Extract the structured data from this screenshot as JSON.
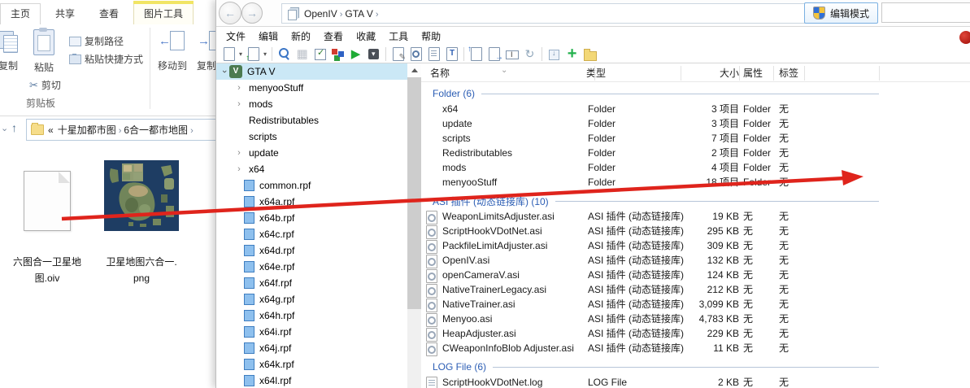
{
  "explorer": {
    "tabs": [
      {
        "id": "home",
        "label": "主页",
        "active": true,
        "contextual": false
      },
      {
        "id": "share",
        "label": "共享",
        "active": false,
        "contextual": false
      },
      {
        "id": "view",
        "label": "查看",
        "active": false,
        "contextual": false
      },
      {
        "id": "picture-tools",
        "label": "图片工具",
        "active": false,
        "contextual": true
      }
    ],
    "ribbon": {
      "copy": "复制",
      "paste": "粘贴",
      "cut": "剪切",
      "copy_path": "复制路径",
      "paste_shortcut": "粘贴快捷方式",
      "clipboard_group": "剪贴板",
      "move_to": "移动到",
      "copy_to": "复制到"
    },
    "address": {
      "prefix": "«",
      "crumbs": [
        "十星加都市图",
        "6合一都市地图"
      ]
    },
    "files": [
      {
        "id": "oiv",
        "name": "六图合一卫星地图.oiv",
        "line1": "六图合一卫星地",
        "line2": "图.oiv",
        "icon": "oiv-document"
      },
      {
        "id": "png",
        "name": "卫星地图六合一.png",
        "line1": "卫星地图六合一.",
        "line2": "png",
        "icon": "map-thumbnail"
      }
    ]
  },
  "openiv": {
    "breadcrumbs": [
      "OpenIV",
      "GTA V"
    ],
    "edit_mode_label": "编辑模式",
    "menus": [
      {
        "id": "file",
        "label": "文件"
      },
      {
        "id": "edit",
        "label": "编辑"
      },
      {
        "id": "new",
        "label": "新的"
      },
      {
        "id": "view",
        "label": "查看"
      },
      {
        "id": "favorites",
        "label": "收藏"
      },
      {
        "id": "tools",
        "label": "工具"
      },
      {
        "id": "help",
        "label": "帮助"
      }
    ],
    "toolbar": [
      {
        "id": "new-file",
        "drop": true
      },
      {
        "id": "import-file",
        "drop": true
      },
      {
        "sep": true
      },
      {
        "id": "search"
      },
      {
        "id": "settings"
      },
      {
        "id": "checklist"
      },
      {
        "id": "palette"
      },
      {
        "id": "play"
      },
      {
        "id": "save"
      },
      {
        "sep": true
      },
      {
        "id": "edit"
      },
      {
        "id": "preview"
      },
      {
        "id": "view-text"
      },
      {
        "id": "text-editor"
      },
      {
        "sep": true
      },
      {
        "id": "export"
      },
      {
        "id": "copy"
      },
      {
        "id": "rename"
      },
      {
        "id": "refresh"
      },
      {
        "sep": true
      },
      {
        "id": "extract"
      },
      {
        "id": "add"
      },
      {
        "id": "new-folder"
      }
    ],
    "tree": {
      "root": "GTA V",
      "items": [
        {
          "label": "menyooStuff",
          "icon": "folder-yellow",
          "expandable": true
        },
        {
          "label": "mods",
          "icon": "folder-purple",
          "expandable": true
        },
        {
          "label": "Redistributables",
          "icon": "folder-yellow",
          "expandable": false
        },
        {
          "label": "scripts",
          "icon": "folder-yellow",
          "expandable": false
        },
        {
          "label": "update",
          "icon": "folder-blue",
          "expandable": true
        },
        {
          "label": "x64",
          "icon": "folder-teal",
          "expandable": true
        },
        {
          "label": "common.rpf",
          "icon": "rpf",
          "expandable": false
        },
        {
          "label": "x64a.rpf",
          "icon": "rpf",
          "expandable": false
        },
        {
          "label": "x64b.rpf",
          "icon": "rpf",
          "expandable": false
        },
        {
          "label": "x64c.rpf",
          "icon": "rpf",
          "expandable": false
        },
        {
          "label": "x64d.rpf",
          "icon": "rpf",
          "expandable": false
        },
        {
          "label": "x64e.rpf",
          "icon": "rpf",
          "expandable": false
        },
        {
          "label": "x64f.rpf",
          "icon": "rpf",
          "expandable": false
        },
        {
          "label": "x64g.rpf",
          "icon": "rpf",
          "expandable": false
        },
        {
          "label": "x64h.rpf",
          "icon": "rpf",
          "expandable": false
        },
        {
          "label": "x64i.rpf",
          "icon": "rpf",
          "expandable": false
        },
        {
          "label": "x64j.rpf",
          "icon": "rpf",
          "expandable": false
        },
        {
          "label": "x64k.rpf",
          "icon": "rpf",
          "expandable": false
        },
        {
          "label": "x64l.rpf",
          "icon": "rpf",
          "expandable": false
        }
      ]
    },
    "list": {
      "columns": [
        "名称",
        "类型",
        "大小",
        "属性",
        "标签"
      ],
      "sections": [
        {
          "title": "Folder (6)",
          "rows": [
            {
              "name": "x64",
              "icon": "folder-teal",
              "type": "Folder",
              "size": "3 项目",
              "attr": "Folder",
              "tag": "无"
            },
            {
              "name": "update",
              "icon": "folder-blue",
              "type": "Folder",
              "size": "3 项目",
              "attr": "Folder",
              "tag": "无"
            },
            {
              "name": "scripts",
              "icon": "folder-yellow",
              "type": "Folder",
              "size": "7 项目",
              "attr": "Folder",
              "tag": "无"
            },
            {
              "name": "Redistributables",
              "icon": "folder-yellow",
              "type": "Folder",
              "size": "2 项目",
              "attr": "Folder",
              "tag": "无"
            },
            {
              "name": "mods",
              "icon": "folder-purple",
              "type": "Folder",
              "size": "4 项目",
              "attr": "Folder",
              "tag": "无"
            },
            {
              "name": "menyooStuff",
              "icon": "folder-yellow",
              "type": "Folder",
              "size": "18 项目",
              "attr": "Folder",
              "tag": "无"
            }
          ]
        },
        {
          "title": "ASI 插件 (动态链接库) (10)",
          "rows": [
            {
              "name": "WeaponLimitsAdjuster.asi",
              "icon": "asi",
              "type": "ASI 插件 (动态链接库)",
              "size": "19 KB",
              "attr": "无",
              "tag": "无"
            },
            {
              "name": "ScriptHookVDotNet.asi",
              "icon": "asi",
              "type": "ASI 插件 (动态链接库)",
              "size": "295 KB",
              "attr": "无",
              "tag": "无"
            },
            {
              "name": "PackfileLimitAdjuster.asi",
              "icon": "asi",
              "type": "ASI 插件 (动态链接库)",
              "size": "309 KB",
              "attr": "无",
              "tag": "无"
            },
            {
              "name": "OpenIV.asi",
              "icon": "asi",
              "type": "ASI 插件 (动态链接库)",
              "size": "132 KB",
              "attr": "无",
              "tag": "无"
            },
            {
              "name": "openCameraV.asi",
              "icon": "asi",
              "type": "ASI 插件 (动态链接库)",
              "size": "124 KB",
              "attr": "无",
              "tag": "无"
            },
            {
              "name": "NativeTrainerLegacy.asi",
              "icon": "asi",
              "type": "ASI 插件 (动态链接库)",
              "size": "212 KB",
              "attr": "无",
              "tag": "无"
            },
            {
              "name": "NativeTrainer.asi",
              "icon": "asi",
              "type": "ASI 插件 (动态链接库)",
              "size": "3,099 KB",
              "attr": "无",
              "tag": "无"
            },
            {
              "name": "Menyoo.asi",
              "icon": "asi",
              "type": "ASI 插件 (动态链接库)",
              "size": "4,783 KB",
              "attr": "无",
              "tag": "无"
            },
            {
              "name": "HeapAdjuster.asi",
              "icon": "asi",
              "type": "ASI 插件 (动态链接库)",
              "size": "229 KB",
              "attr": "无",
              "tag": "无"
            },
            {
              "name": "CWeaponInfoBlob Adjuster.asi",
              "icon": "asi",
              "type": "ASI 插件 (动态链接库)",
              "size": "11 KB",
              "attr": "无",
              "tag": "无"
            }
          ]
        },
        {
          "title": "LOG File (6)",
          "rows": [
            {
              "name": "ScriptHookVDotNet.log",
              "icon": "log",
              "type": "LOG File",
              "size": "2 KB",
              "attr": "无",
              "tag": "无"
            }
          ]
        }
      ]
    }
  },
  "colors": {
    "accent_blue": "#2b5db4",
    "arrow_red": "#df241c",
    "selection_blue": "#cbe8f6",
    "contextual_tab_yellow": "#f1e564",
    "folder_yellow": "#f3d877",
    "folder_purple": "#9e93e2",
    "folder_blue": "#3fa3f0",
    "folder_teal": "#8fb9ab",
    "rpf_blue": "#8ec0ee",
    "record_dot_red": "#9c0b05"
  }
}
